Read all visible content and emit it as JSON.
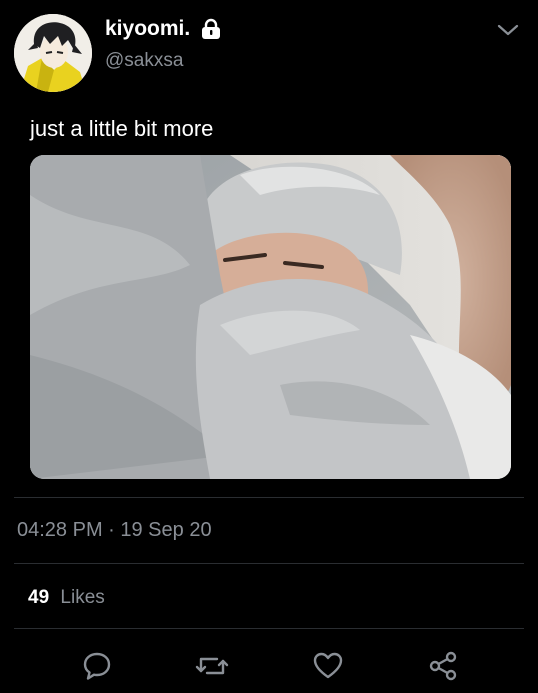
{
  "tweet": {
    "display_name": "kiyoomi.",
    "handle": "@sakxsa",
    "text": "just a little bit more",
    "time": "04:28 PM · 19 Sep 20"
  },
  "stats": {
    "likes_count": "49",
    "likes_label": "Likes"
  },
  "icons": {
    "lock": "lock-icon",
    "caret": "chevron-down-icon",
    "reply": "reply-icon",
    "retweet": "retweet-icon",
    "like": "heart-icon",
    "share": "share-icon"
  },
  "colors": {
    "background": "#000000",
    "text_primary": "#ffffff",
    "text_secondary": "#8a8f96",
    "divider": "#2a2d31",
    "icon": "#8a8f96"
  }
}
